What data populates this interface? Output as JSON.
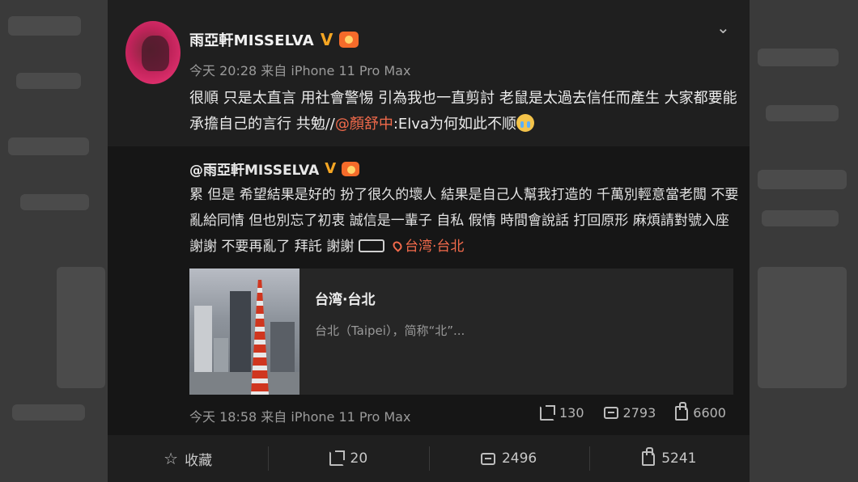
{
  "post": {
    "author": "雨亞軒MISSELVA",
    "verified_mark": "V",
    "meta": "今天 20:28 来自 iPhone 11 Pro Max",
    "text_part1": "很順 只是太直言 用社會警惕 引為我也一直剪討 老鼠是太過去信任而產生 大家都要能承擔自己的言行 共勉//",
    "mention": "@顏舒中",
    "text_part2": ":Elva为何如此不顺",
    "emoji": "cry-emoji"
  },
  "repost": {
    "author": "@雨亞軒MISSELVA",
    "verified_mark": "V",
    "text": "累 但是 希望結果是好的 扮了很久的壞人 結果是自己人幫我打造的 千萬別輕意當老闆 不要亂給同情 但也別忘了初衷 誠信是一輩子 自私 假情 時間會說話 打回原形 麻煩請對號入座 謝謝 不要再亂了 拜託 謝謝",
    "location": "台湾·台北",
    "link_card": {
      "title": "台湾·台北",
      "description": "台北（Taipei），简称“北”..."
    },
    "meta": "今天 18:58 来自 iPhone 11 Pro Max",
    "stats": {
      "reposts": "130",
      "comments": "2793",
      "likes": "6600"
    }
  },
  "footer": {
    "favorite_label": "收藏",
    "reposts": "20",
    "comments": "2496",
    "likes": "5241"
  },
  "icons": [
    "chevron-down-icon",
    "share-icon",
    "comment-icon",
    "like-icon",
    "star-icon",
    "location-pin-icon"
  ],
  "colors": {
    "mention": "#f26a4b",
    "verified": "#f5a623",
    "background": "#1f1f1f",
    "repost_background": "#161616"
  }
}
